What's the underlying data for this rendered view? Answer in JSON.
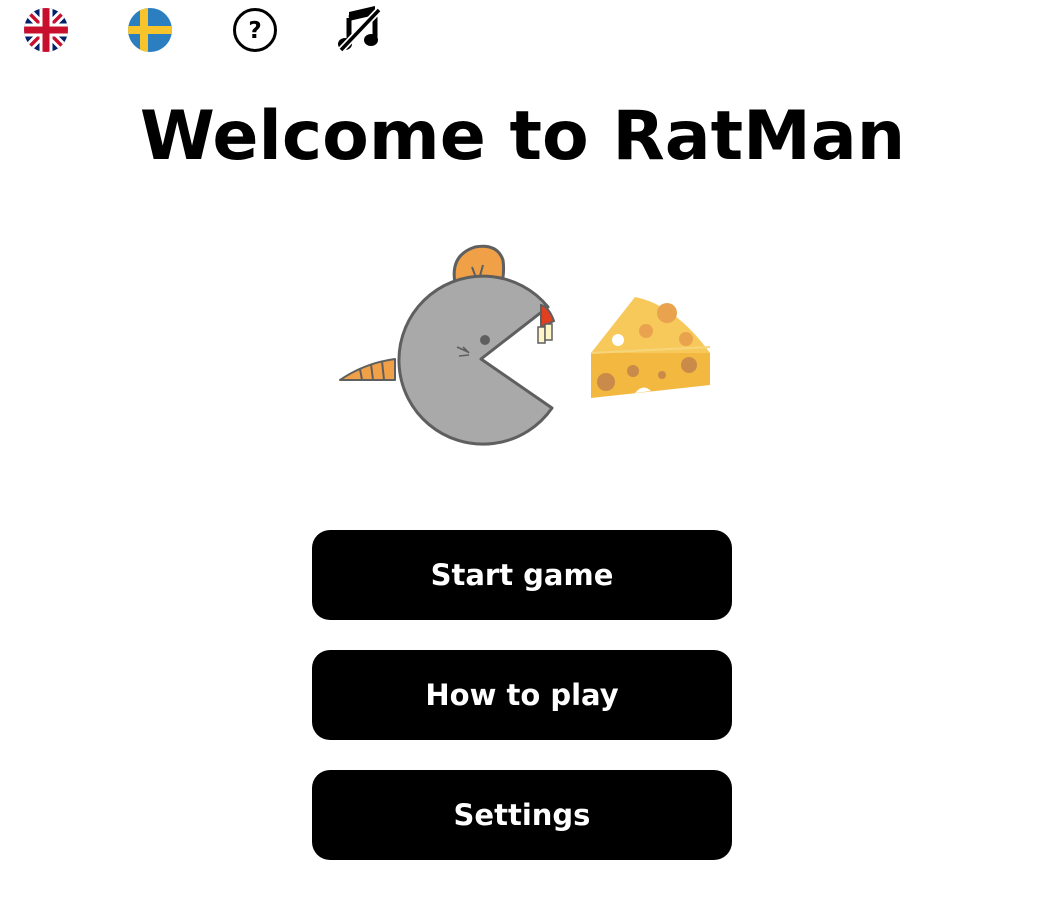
{
  "topbar": {
    "icons": [
      {
        "name": "uk-flag-icon",
        "label": "English"
      },
      {
        "name": "swedish-flag-icon",
        "label": "Swedish"
      },
      {
        "name": "help-icon",
        "label": "?"
      },
      {
        "name": "music-off-icon",
        "label": "Music off"
      }
    ],
    "help_glyph": "?"
  },
  "title": "Welcome to RatMan",
  "menu": {
    "start_label": "Start game",
    "howto_label": "How to play",
    "settings_label": "Settings"
  },
  "colors": {
    "rat_body": "#a9a9a9",
    "rat_outline": "#5f5f5f",
    "ear": "#f0a047",
    "tail": "#f0a047",
    "nose": "#e04020",
    "cheese": "#f7c85a",
    "cheese_side": "#f3b83f",
    "cheese_holes": "#d9894a",
    "button_bg": "#000000",
    "button_text": "#ffffff"
  }
}
